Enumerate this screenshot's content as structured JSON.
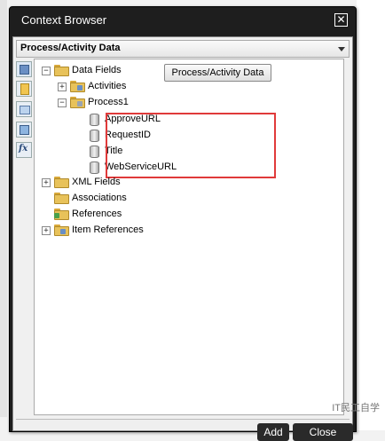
{
  "window": {
    "title": "Context Browser",
    "close_icon": "close-icon"
  },
  "selector": {
    "value": "Process/Activity Data"
  },
  "toolbar": {
    "icons": [
      "form-icon",
      "page-icon",
      "data-icon",
      "grid-icon",
      "function-icon"
    ],
    "function_text": "fx"
  },
  "tree": {
    "data_fields": {
      "label": "Data Fields",
      "expander": "−"
    },
    "activities": {
      "label": "Activities",
      "expander": "+"
    },
    "process1": {
      "label": "Process1",
      "expander": "−"
    },
    "fields": [
      "ApproveURL",
      "RequestID",
      "Title",
      "WebServiceURL"
    ],
    "xml_fields": {
      "label": "XML Fields",
      "expander": "+"
    },
    "associations": {
      "label": "Associations"
    },
    "references": {
      "label": "References"
    },
    "item_references": {
      "label": "Item References",
      "expander": "+"
    }
  },
  "insert_button": {
    "label": "Process/Activity Data"
  },
  "footer": {
    "add_label": "Add",
    "close_label": "Close"
  },
  "watermark": "IT民工自学",
  "colors": {
    "highlight": "#e03a3a",
    "title_bar": "#1e1e1e",
    "folder": "#e8c25a"
  }
}
